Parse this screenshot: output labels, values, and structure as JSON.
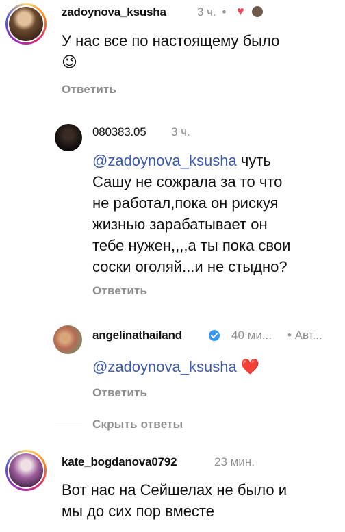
{
  "comments": [
    {
      "username": "zadoynova_ksusha",
      "time": "3 ч.",
      "separator": "•",
      "text": "У нас все по настоящему было",
      "emoji": "😉",
      "reply_label": "Ответить"
    },
    {
      "username": "080383.05",
      "time": "3 ч.",
      "mention": "@zadoynova_ksusha",
      "text_after_mention": "чуть",
      "lines": [
        "Сашу не сожрала за то что",
        "не работал,пока он рискуя",
        "жизнью зарабатывает он",
        "тебе нужен,,,,а ты пока свои",
        "соски оголяй...и не стыдно?"
      ],
      "reply_label": "Ответить"
    },
    {
      "username": "angelinathailand",
      "time": "40 ми...",
      "author_badge": "• Авт...",
      "mention": "@zadoynova_ksusha",
      "emoji": "❤️",
      "reply_label": "Ответить"
    },
    {
      "username": "kate_bogdanova0792",
      "time": "23 мин.",
      "lines": [
        "Вот нас на Сейшелах не было и",
        "мы до сих пор вместе"
      ]
    }
  ],
  "hide_replies_label": "Скрыть ответы",
  "colors": {
    "mention": "#3b5aa8",
    "heart": "#ed4956",
    "verified": "#3897f0",
    "muted": "#8e8e8e"
  }
}
